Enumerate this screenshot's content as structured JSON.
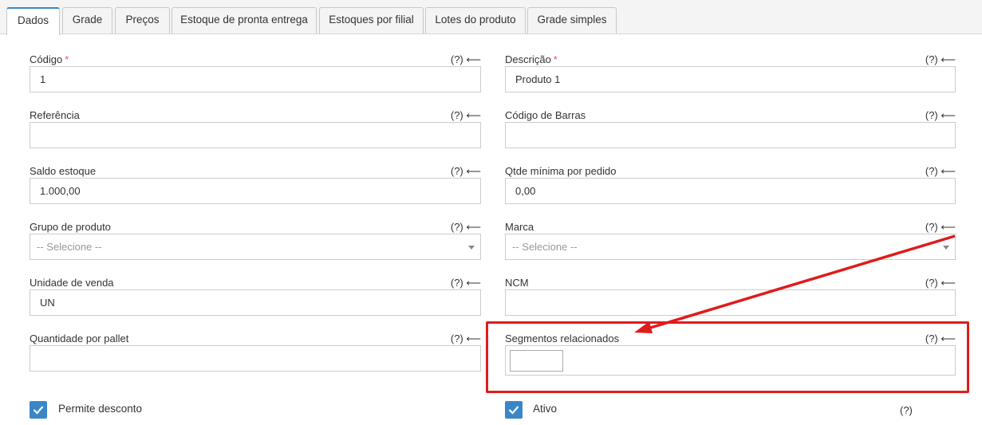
{
  "tabs": [
    {
      "label": "Dados",
      "active": true
    },
    {
      "label": "Grade"
    },
    {
      "label": "Preços"
    },
    {
      "label": "Estoque de pronta entrega"
    },
    {
      "label": "Estoques por filial"
    },
    {
      "label": "Lotes do produto"
    },
    {
      "label": "Grade simples"
    }
  ],
  "help_text": "(?) ⟵",
  "required_mark": "*",
  "fields": {
    "codigo": {
      "label": "Código",
      "value": "1",
      "required": true
    },
    "descricao": {
      "label": "Descrição",
      "value": "Produto 1",
      "required": true
    },
    "referencia": {
      "label": "Referência",
      "value": ""
    },
    "codigo_barras": {
      "label": "Código de Barras",
      "value": ""
    },
    "saldo_estoque": {
      "label": "Saldo estoque",
      "value": "1.000,00"
    },
    "qtde_minima": {
      "label": "Qtde mínima por pedido",
      "value": "0,00"
    },
    "grupo_produto": {
      "label": "Grupo de produto",
      "placeholder": "-- Selecione --"
    },
    "marca": {
      "label": "Marca",
      "placeholder": "-- Selecione --"
    },
    "unidade_venda": {
      "label": "Unidade de venda",
      "value": "UN"
    },
    "ncm": {
      "label": "NCM",
      "value": ""
    },
    "quantidade_pallet": {
      "label": "Quantidade por pallet",
      "value": ""
    },
    "segmentos": {
      "label": "Segmentos relacionados",
      "value": ""
    }
  },
  "checkboxes": {
    "permite_desconto": {
      "label": "Permite desconto",
      "checked": true
    },
    "ativo": {
      "label": "Ativo",
      "checked": true,
      "help": "(?)"
    }
  },
  "annotation": {
    "color": "#e01b1b"
  },
  "colors": {
    "accent": "#3a87c8"
  }
}
